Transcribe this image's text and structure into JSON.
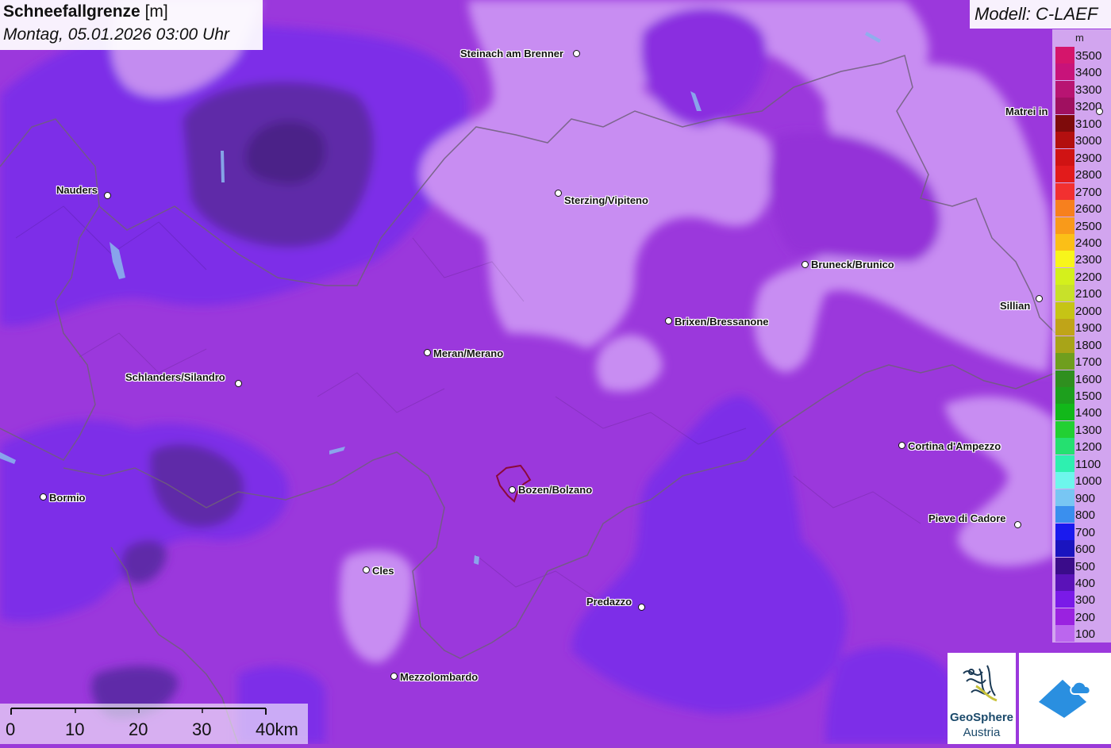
{
  "header": {
    "title": "Schneefallgrenze",
    "unit": "[m]",
    "datetime": "Montag, 05.01.2026 03:00 Uhr",
    "model": "Modell: C-LAEF"
  },
  "legend": {
    "unit": "m",
    "items": [
      {
        "label": "3500",
        "color": "#d5156b"
      },
      {
        "label": "3400",
        "color": "#c8137a"
      },
      {
        "label": "3300",
        "color": "#b81472"
      },
      {
        "label": "3200",
        "color": "#a01060"
      },
      {
        "label": "3100",
        "color": "#7e0b0b"
      },
      {
        "label": "3000",
        "color": "#b30f0f"
      },
      {
        "label": "2900",
        "color": "#d01313"
      },
      {
        "label": "2800",
        "color": "#e21b1b"
      },
      {
        "label": "2700",
        "color": "#f23030"
      },
      {
        "label": "2600",
        "color": "#f7801e"
      },
      {
        "label": "2500",
        "color": "#f99a1a"
      },
      {
        "label": "2400",
        "color": "#fbbf17"
      },
      {
        "label": "2300",
        "color": "#f8f51b"
      },
      {
        "label": "2200",
        "color": "#d4f01c"
      },
      {
        "label": "2100",
        "color": "#c8e12a"
      },
      {
        "label": "2000",
        "color": "#c6c415"
      },
      {
        "label": "1900",
        "color": "#c0a418"
      },
      {
        "label": "1800",
        "color": "#a8a418"
      },
      {
        "label": "1700",
        "color": "#6f9e1e"
      },
      {
        "label": "1600",
        "color": "#2f8f1f"
      },
      {
        "label": "1500",
        "color": "#1d9f1d"
      },
      {
        "label": "1400",
        "color": "#12b81a"
      },
      {
        "label": "1300",
        "color": "#22d033"
      },
      {
        "label": "1200",
        "color": "#25e070"
      },
      {
        "label": "1100",
        "color": "#2ef0b0"
      },
      {
        "label": "1000",
        "color": "#6ef6ec"
      },
      {
        "label": "900",
        "color": "#78c6f3"
      },
      {
        "label": "800",
        "color": "#3a8fee"
      },
      {
        "label": "700",
        "color": "#1a1aee"
      },
      {
        "label": "600",
        "color": "#1a14bf"
      },
      {
        "label": "500",
        "color": "#3a0c8a"
      },
      {
        "label": "400",
        "color": "#5a12b8"
      },
      {
        "label": "300",
        "color": "#7a1ae8"
      },
      {
        "label": "200",
        "color": "#9a22e0"
      },
      {
        "label": "100",
        "color": "#bb66ee"
      }
    ]
  },
  "cities": [
    {
      "name": "Steinach am Brenner"
    },
    {
      "name": "Matrei in"
    },
    {
      "name": "Nauders"
    },
    {
      "name": "Sterzing/Vipiteno"
    },
    {
      "name": "Bruneck/Brunico"
    },
    {
      "name": "Sillian"
    },
    {
      "name": "Brixen/Bressanone"
    },
    {
      "name": "Meran/Merano"
    },
    {
      "name": "Schlanders/Silandro"
    },
    {
      "name": "Cortina d'Ampezzo"
    },
    {
      "name": "Bozen/Bolzano"
    },
    {
      "name": "Bormio"
    },
    {
      "name": "Pieve di Cadore"
    },
    {
      "name": "Cles"
    },
    {
      "name": "Predazzo"
    },
    {
      "name": "Mezzolombardo"
    }
  ],
  "scalebar": {
    "labels": [
      "0",
      "10",
      "20",
      "30",
      "40km"
    ]
  },
  "logos": {
    "geosphere_line1": "GeoSphere",
    "geosphere_line2": "Austria"
  }
}
